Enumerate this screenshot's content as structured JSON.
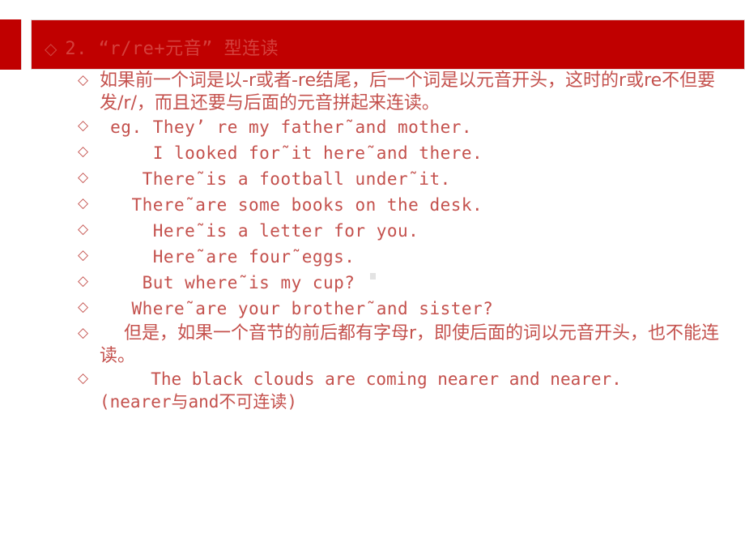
{
  "slide": {
    "background_color": "#ffffff",
    "banner_color": "#c00000",
    "title_text_color": "#d4403c",
    "body_text_color": "#c4514d"
  },
  "title": {
    "bullet": "◇",
    "text": "2.  “r/re+元音” 型连读"
  },
  "bullets": {
    "glyph": "◇"
  },
  "body": {
    "lines": [
      {
        "id": "rule-paragraph",
        "kind": "cn",
        "text": "如果前一个词是以-r或者-re结尾，后一个词是以元音开头，这时的r或re不但要发/r/，而且还要与后面的元音拼起来连读。"
      },
      {
        "id": "example-1",
        "kind": "en",
        "text": " eg. They’ re my father˜and mother."
      },
      {
        "id": "example-2",
        "kind": "en",
        "text": "     I looked for˜it here˜and there."
      },
      {
        "id": "example-3",
        "kind": "en",
        "text": "    There˜is a football under˜it."
      },
      {
        "id": "example-4",
        "kind": "en",
        "text": "   There˜are some books on the desk."
      },
      {
        "id": "example-5",
        "kind": "en",
        "text": "     Here˜is a letter for you."
      },
      {
        "id": "example-6",
        "kind": "en",
        "text": "     Here˜are four˜eggs."
      },
      {
        "id": "example-7",
        "kind": "en",
        "text": "    But where˜is my cup?"
      },
      {
        "id": "example-8",
        "kind": "en",
        "text": "   Where˜are your brother˜and sister?"
      },
      {
        "id": "exception-paragraph",
        "kind": "cn-indent",
        "text": "但是，如果一个音节的前后都有字母r，即使后面的词以元音开头，也不能连读。"
      },
      {
        "id": "exception-example",
        "kind": "mix",
        "text": "     The black clouds are coming nearer and nearer.\n(nearer与and不可连读)"
      }
    ]
  }
}
